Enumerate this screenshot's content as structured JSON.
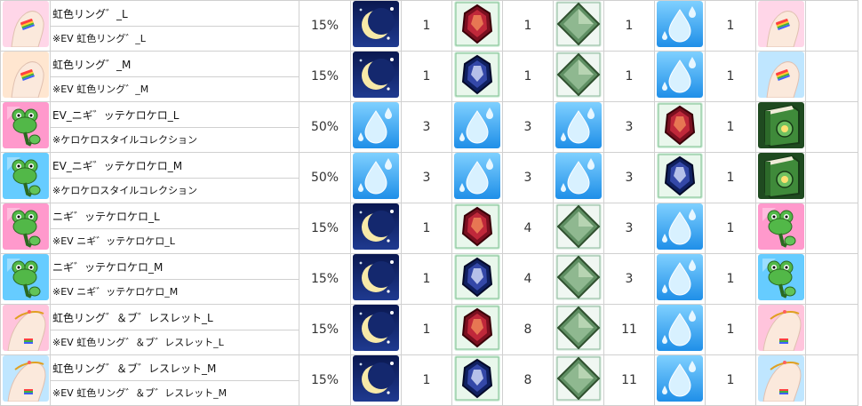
{
  "rows": [
    {
      "name": "虹色リング゛_L",
      "note": "※EV 虹色リング゛_L",
      "rate": "15%",
      "item_icon": "rainbow-ring-hand-icon",
      "item_bg": "#ffd6e8",
      "mats": [
        {
          "icon": "crescent-moon-icon",
          "n": "1"
        },
        {
          "icon": "red-gem-icon",
          "n": "1"
        },
        {
          "icon": "green-crystal-icon",
          "n": "1"
        },
        {
          "icon": "water-drop-icon",
          "n": "1"
        }
      ],
      "result_icon": "rainbow-ring-hand-icon",
      "result_bg": "#ffd6e8"
    },
    {
      "name": "虹色リング゛_M",
      "note": "※EV 虹色リング゛_M",
      "rate": "15%",
      "item_icon": "rainbow-ring-hand-icon",
      "item_bg": "#ffe6d0",
      "mats": [
        {
          "icon": "crescent-moon-icon",
          "n": "1"
        },
        {
          "icon": "blue-gem-icon",
          "n": "1"
        },
        {
          "icon": "green-crystal-icon",
          "n": "1"
        },
        {
          "icon": "water-drop-icon",
          "n": "1"
        }
      ],
      "result_icon": "rainbow-ring-hand-icon",
      "result_bg": "#bfe6ff"
    },
    {
      "name": "EV_ニギ゛ッテケロケロ_L",
      "note": "※ケロケロスタイルコレクション",
      "rate": "50%",
      "item_icon": "green-frog-icon",
      "item_bg": "#ff99cc",
      "mats": [
        {
          "icon": "water-drop-icon",
          "n": "3"
        },
        {
          "icon": "water-drop-icon",
          "n": "3"
        },
        {
          "icon": "water-drop-icon",
          "n": "3"
        },
        {
          "icon": "red-gem-icon",
          "n": "1"
        }
      ],
      "result_icon": "green-book-icon",
      "result_bg": "#2f6b2f"
    },
    {
      "name": "EV_ニギ゛ッテケロケロ_M",
      "note": "※ケロケロスタイルコレクション",
      "rate": "50%",
      "item_icon": "green-frog-icon",
      "item_bg": "#66ccff",
      "mats": [
        {
          "icon": "water-drop-icon",
          "n": "3"
        },
        {
          "icon": "water-drop-icon",
          "n": "3"
        },
        {
          "icon": "water-drop-icon",
          "n": "3"
        },
        {
          "icon": "blue-gem-icon",
          "n": "1"
        }
      ],
      "result_icon": "green-book-icon",
      "result_bg": "#2f6b2f"
    },
    {
      "name": "ニギ゛ッテケロケロ_L",
      "note": "※EV ニギ゛ッテケロケロ_L",
      "rate": "15%",
      "item_icon": "green-frog-icon",
      "item_bg": "#ff99cc",
      "mats": [
        {
          "icon": "crescent-moon-icon",
          "n": "1"
        },
        {
          "icon": "red-gem-icon",
          "n": "4"
        },
        {
          "icon": "green-crystal-icon",
          "n": "3"
        },
        {
          "icon": "water-drop-icon",
          "n": "1"
        }
      ],
      "result_icon": "green-frog-icon",
      "result_bg": "#ff99cc"
    },
    {
      "name": "ニギ゛ッテケロケロ_M",
      "note": "※EV ニギ゛ッテケロケロ_M",
      "rate": "15%",
      "item_icon": "green-frog-icon",
      "item_bg": "#66ccff",
      "mats": [
        {
          "icon": "crescent-moon-icon",
          "n": "1"
        },
        {
          "icon": "blue-gem-icon",
          "n": "4"
        },
        {
          "icon": "green-crystal-icon",
          "n": "3"
        },
        {
          "icon": "water-drop-icon",
          "n": "1"
        }
      ],
      "result_icon": "green-frog-icon",
      "result_bg": "#66ccff"
    },
    {
      "name": "虹色リング゛＆ブ゛レスレット_L",
      "note": "※EV 虹色リング゛＆ブ゛レスレット_L",
      "rate": "15%",
      "item_icon": "rainbow-ring-bracelet-hand-icon",
      "item_bg": "#ffc4dc",
      "mats": [
        {
          "icon": "crescent-moon-icon",
          "n": "1"
        },
        {
          "icon": "red-gem-icon",
          "n": "8"
        },
        {
          "icon": "green-crystal-icon",
          "n": "11"
        },
        {
          "icon": "water-drop-icon",
          "n": "1"
        }
      ],
      "result_icon": "rainbow-ring-bracelet-hand-icon",
      "result_bg": "#ffc4dc"
    },
    {
      "name": "虹色リング゛＆ブ゛レスレット_M",
      "note": "※EV 虹色リング゛＆ブ゛レスレット_M",
      "rate": "15%",
      "item_icon": "rainbow-ring-bracelet-hand-icon",
      "item_bg": "#bfe6ff",
      "mats": [
        {
          "icon": "crescent-moon-icon",
          "n": "1"
        },
        {
          "icon": "blue-gem-icon",
          "n": "8"
        },
        {
          "icon": "green-crystal-icon",
          "n": "11"
        },
        {
          "icon": "water-drop-icon",
          "n": "1"
        }
      ],
      "result_icon": "rainbow-ring-bracelet-hand-icon",
      "result_bg": "#bfe6ff"
    }
  ]
}
